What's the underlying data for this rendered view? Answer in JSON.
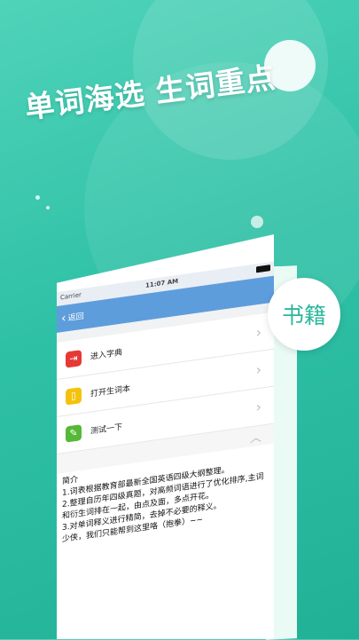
{
  "headline": "单词海选 生词重点",
  "badge": "书籍",
  "status": {
    "carrier": "Carrier",
    "time": "11:07 AM"
  },
  "nav": {
    "back_label": "返回"
  },
  "menu": [
    {
      "label": "进入字典",
      "icon": "dictionary-icon",
      "color": "#e53935"
    },
    {
      "label": "打开生词本",
      "icon": "notebook-icon",
      "color": "#f4c20d"
    },
    {
      "label": "测试一下",
      "icon": "pencil-icon",
      "color": "#56b837"
    }
  ],
  "intro": {
    "title": "简介",
    "lines": [
      "1.词表根据教育部最新全国英语四级大纲整理。",
      "2.整理自历年四级真题，对高频词语进行了优化排序,主词和衍生词排在一起，由点及面，多点开花。",
      "3.对单词释义进行精简，去掉不必要的释义。",
      "少侠，我们只能帮到这里咯（抱拳）~~"
    ]
  }
}
